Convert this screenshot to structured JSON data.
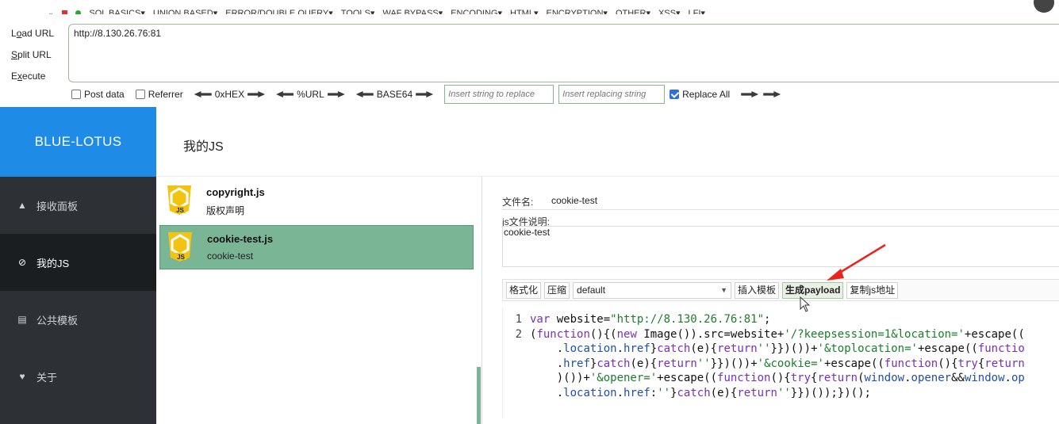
{
  "hackbar": {
    "menu": [
      "SQL BASICS▾",
      "UNION BASED▾",
      "ERROR/DOUBLE QUERY▾",
      "TOOLS▾",
      "WAF BYPASS▾",
      "ENCODING▾",
      "HTML▾",
      "ENCRYPTION▾",
      "OTHER▾",
      "XSS▾",
      "LFI▾"
    ],
    "side": {
      "load": "Load URL",
      "split": "Split URL",
      "execute": "Execute"
    },
    "url": "http://8.130.26.76:81",
    "post_data": "Post data",
    "referrer": "Referrer",
    "hex": "0xHEX",
    "urlenc": "%URL",
    "base64": "BASE64",
    "replace_placeholder": "Insert string to replace",
    "replacing_placeholder": "Insert replacing string",
    "replace_all": "Replace All"
  },
  "app": {
    "brand": "BLUE-LOTUS",
    "page_title": "我的JS",
    "nav": [
      {
        "label": "接收面板",
        "icon": "inbox-icon"
      },
      {
        "label": "我的JS",
        "icon": "paperclip-icon"
      },
      {
        "label": "公共模板",
        "icon": "file-icon"
      },
      {
        "label": "关于",
        "icon": "heart-icon"
      }
    ],
    "js_files": [
      {
        "name": "copyright.js",
        "desc": "版权声明"
      },
      {
        "name": "cookie-test.js",
        "desc": "cookie-test"
      }
    ],
    "editor": {
      "filename_label": "文件名:",
      "filename": "cookie-test",
      "desc_label": "js文件说明:",
      "desc": "cookie-test",
      "buttons": {
        "format": "格式化",
        "compress": "压缩",
        "insert": "插入模板",
        "generate": "生成payload",
        "copy": "复制js地址"
      },
      "template_select": "default",
      "code_lines": [
        "1",
        "2"
      ]
    }
  },
  "colors": {
    "brand": "#1e8be6",
    "sidebar": "#2d3135",
    "active_js": "#7ab595"
  }
}
